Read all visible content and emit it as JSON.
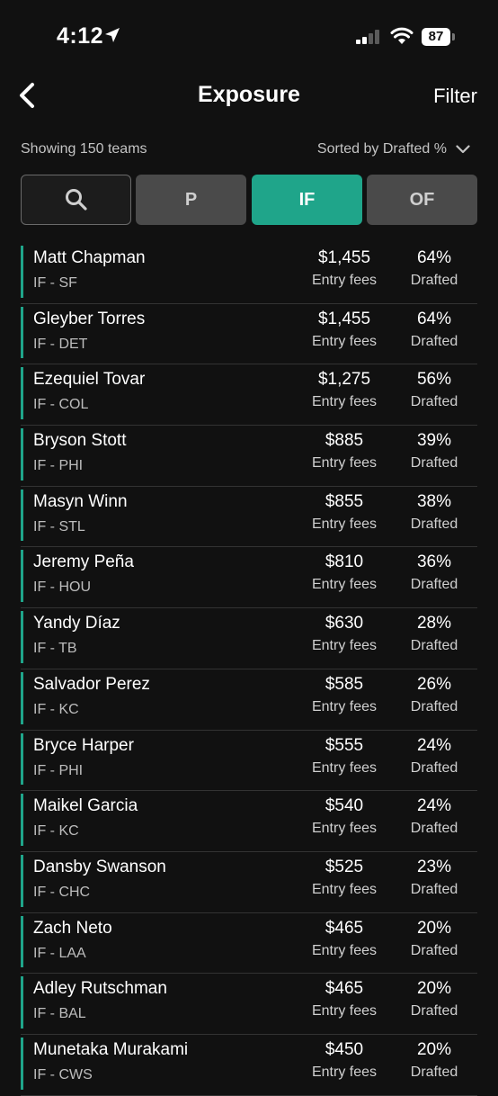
{
  "status_bar": {
    "time": "4:12",
    "battery": "87"
  },
  "header": {
    "title": "Exposure",
    "filter_label": "Filter",
    "back_icon": "chevron-left-icon"
  },
  "summary": {
    "showing": "Showing 150 teams",
    "sorted": "Sorted by Drafted %"
  },
  "tabs": {
    "search_icon": "search-icon",
    "p": "P",
    "if": "IF",
    "of": "OF",
    "active": "IF"
  },
  "colors": {
    "accent": "#1fa58a",
    "background": "#111111",
    "tab_inactive": "#4a4a4a"
  },
  "fee_label": "Entry fees",
  "drafted_label": "Drafted",
  "players": [
    {
      "name": "Matt Chapman",
      "pos": "IF - SF",
      "fee": "$1,455",
      "pct": "64%"
    },
    {
      "name": "Gleyber Torres",
      "pos": "IF - DET",
      "fee": "$1,455",
      "pct": "64%"
    },
    {
      "name": "Ezequiel Tovar",
      "pos": "IF - COL",
      "fee": "$1,275",
      "pct": "56%"
    },
    {
      "name": "Bryson Stott",
      "pos": "IF - PHI",
      "fee": "$885",
      "pct": "39%"
    },
    {
      "name": "Masyn Winn",
      "pos": "IF - STL",
      "fee": "$855",
      "pct": "38%"
    },
    {
      "name": "Jeremy Peña",
      "pos": "IF - HOU",
      "fee": "$810",
      "pct": "36%"
    },
    {
      "name": "Yandy Díaz",
      "pos": "IF - TB",
      "fee": "$630",
      "pct": "28%"
    },
    {
      "name": "Salvador Perez",
      "pos": "IF - KC",
      "fee": "$585",
      "pct": "26%"
    },
    {
      "name": "Bryce Harper",
      "pos": "IF - PHI",
      "fee": "$555",
      "pct": "24%"
    },
    {
      "name": "Maikel Garcia",
      "pos": "IF - KC",
      "fee": "$540",
      "pct": "24%"
    },
    {
      "name": "Dansby Swanson",
      "pos": "IF - CHC",
      "fee": "$525",
      "pct": "23%"
    },
    {
      "name": "Zach Neto",
      "pos": "IF - LAA",
      "fee": "$465",
      "pct": "20%"
    },
    {
      "name": "Adley Rutschman",
      "pos": "IF - BAL",
      "fee": "$465",
      "pct": "20%"
    },
    {
      "name": "Munetaka Murakami",
      "pos": "IF - CWS",
      "fee": "$450",
      "pct": "20%"
    }
  ]
}
